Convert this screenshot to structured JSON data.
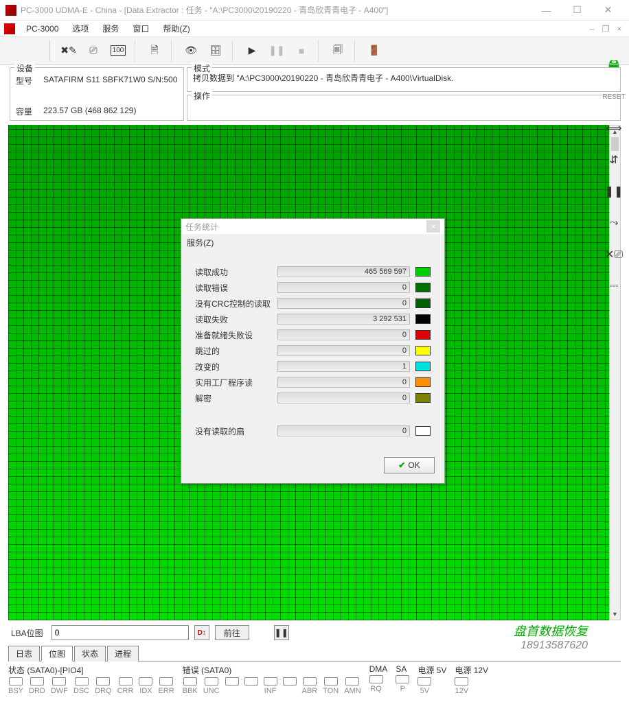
{
  "window": {
    "title": "PC-3000 UDMA-E - China - [Data Extractor : 任务 - \"A:\\PC3000\\20190220 - 青岛欣青青电子 - A400\"]"
  },
  "menu": {
    "app": "PC-3000",
    "items": [
      "选项",
      "服务",
      "窗口",
      "帮助(Z)"
    ]
  },
  "device_panel": {
    "title": "设备",
    "model_label": "型号",
    "model_value": "SATAFIRM   S11 SBFK71W0 S/N:500",
    "capacity_label": "容量",
    "capacity_value": "223.57 GB (468 862 129)"
  },
  "mode_panel": {
    "title": "模式",
    "text": "拷贝数据到 \"A:\\PC3000\\20190220 - 青岛欣青青电子 - A400\\VirtualDisk."
  },
  "op_panel": {
    "title": "操作"
  },
  "lba_bar": {
    "label": "LBA位图",
    "value": "0",
    "goto": "前往"
  },
  "bottom_tabs": [
    "日志",
    "位图",
    "状态",
    "进程"
  ],
  "bottom_active_index": 1,
  "status_bar": {
    "status_title": "状态 (SATA0)-[PIO4]",
    "status_leds": [
      "BSY",
      "DRD",
      "DWF",
      "DSC",
      "DRQ",
      "CRR",
      "IDX",
      "ERR"
    ],
    "error_title": "错误 (SATA0)",
    "error_leds": [
      "BBK",
      "UNC",
      "",
      "",
      "INF",
      "",
      "ABR",
      "TON",
      "AMN"
    ],
    "dma_title": "DMA",
    "dma_leds": [
      "RQ"
    ],
    "sa_title": "SA",
    "sa_leds": [
      "P"
    ],
    "pwr5_title": "电源 5V",
    "pwr5_leds": [
      "5V"
    ],
    "pwr12_title": "电源 12V",
    "pwr12_leds": [
      "12V"
    ]
  },
  "dialog": {
    "title": "任务统计",
    "menu": "服务(Z)",
    "ok": "OK",
    "stats": [
      {
        "name": "读取成功",
        "value": "465 569 597",
        "color": "#00d000"
      },
      {
        "name": "读取错误",
        "value": "0",
        "color": "#007000"
      },
      {
        "name": "没有CRC控制的读取",
        "value": "0",
        "color": "#006000"
      },
      {
        "name": "读取失败",
        "value": "3 292 531",
        "color": "#000000"
      },
      {
        "name": "准备就绪失败设",
        "value": "0",
        "color": "#e00000"
      },
      {
        "name": "跳过的",
        "value": "0",
        "color": "#ffff00"
      },
      {
        "name": "改变的",
        "value": "1",
        "color": "#00e0e0"
      },
      {
        "name": "实用工厂程序读",
        "value": "0",
        "color": "#ff9000"
      },
      {
        "name": "解密",
        "value": "0",
        "color": "#808000"
      }
    ],
    "unread": {
      "name": "没有读取的扇",
      "value": "0",
      "color": "#ffffff"
    }
  },
  "watermark": {
    "line1": "盘首数据恢复",
    "line2": "18913587620"
  }
}
